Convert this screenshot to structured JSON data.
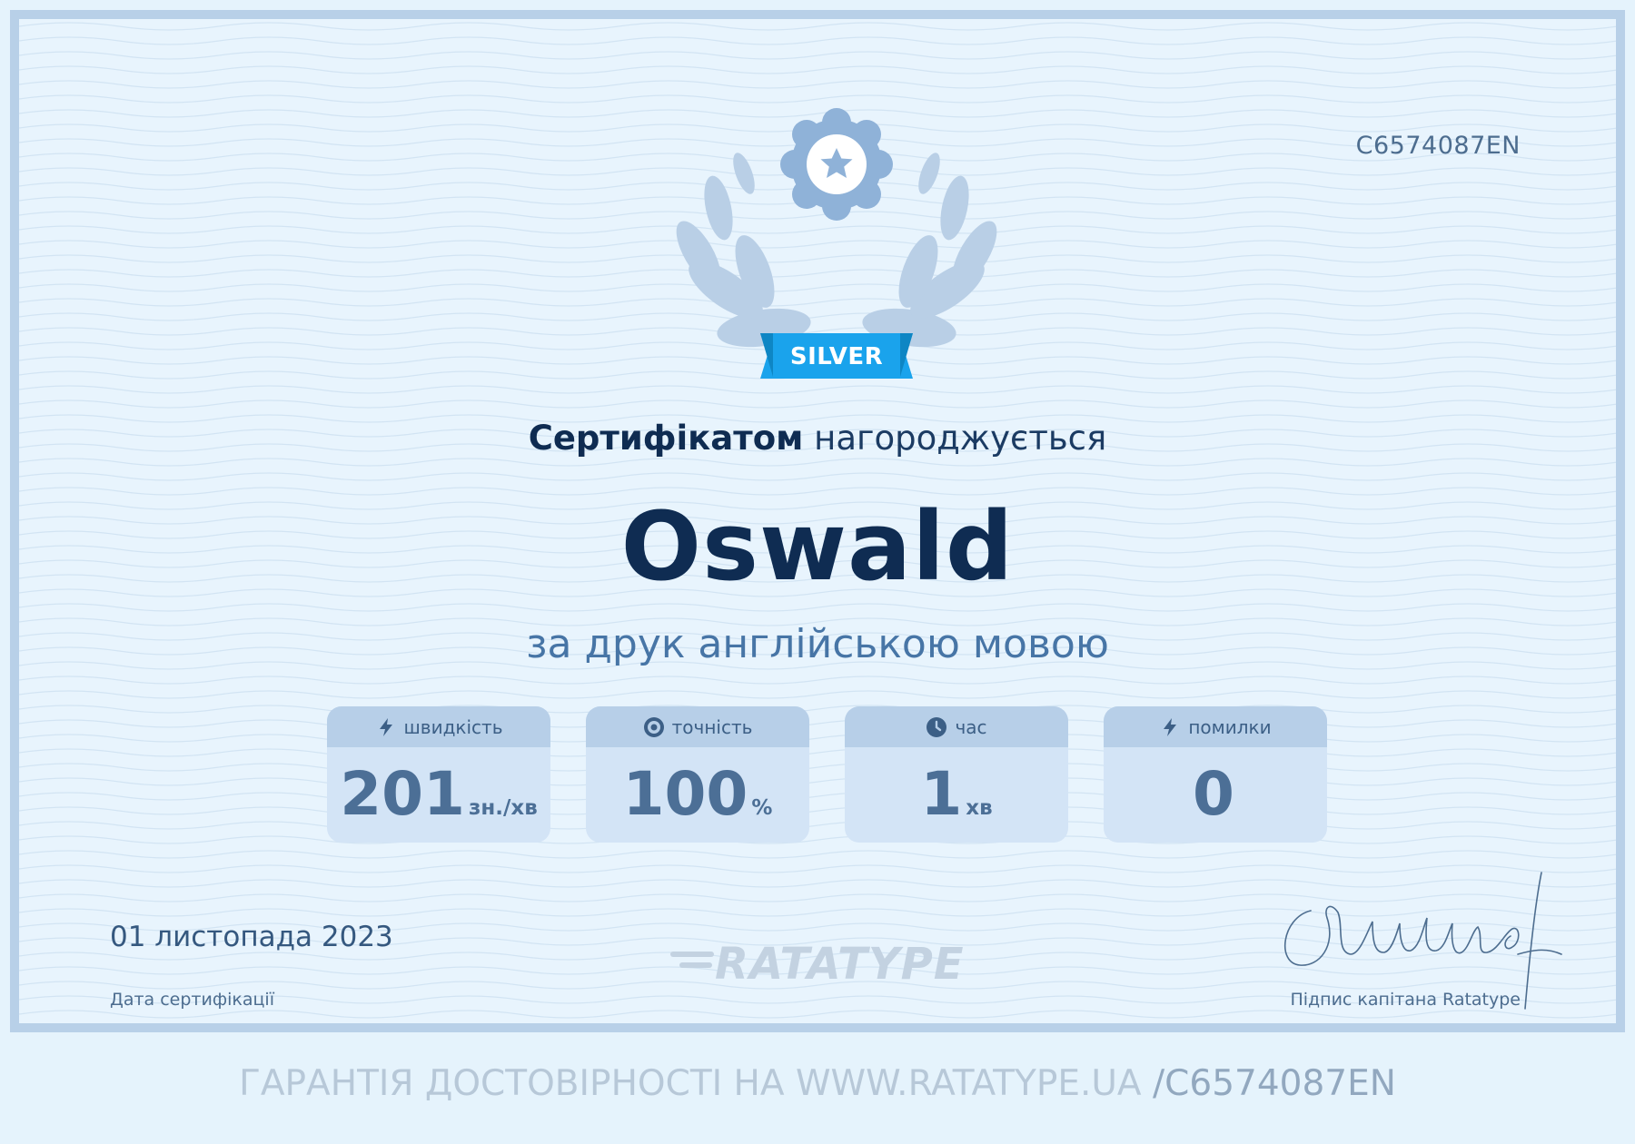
{
  "certificate": {
    "id": "C6574087EN",
    "tier": "SILVER",
    "awarded_bold": "Сертифікатом",
    "awarded_rest": "нагороджується",
    "recipient": "Oswald",
    "reason": "за друк англійською мовою",
    "date": "01 листопада 2023",
    "date_caption": "Дата сертифікації",
    "signature_caption": "Підпис капітана Ratatype",
    "brand": "RATATYPE"
  },
  "stats": [
    {
      "label": "швидкість",
      "value": "201",
      "unit": "зн./хв",
      "icon": "lightning-icon"
    },
    {
      "label": "точність",
      "value": "100",
      "unit": "%",
      "icon": "target-icon"
    },
    {
      "label": "час",
      "value": "1",
      "unit": "хв",
      "icon": "clock-icon"
    },
    {
      "label": "помилки",
      "value": "0",
      "unit": "",
      "icon": "lightning-icon"
    }
  ],
  "verification": {
    "text": "ГАРАНТІЯ ДОСТОВІРНОСТІ НА WWW.RATATYPE.UA",
    "code": "/C6574087EN"
  },
  "colors": {
    "background": "#e8f4fd",
    "frame": "#b8d0e8",
    "navy": "#0f2c52",
    "accent_blue": "#4775a6",
    "ribbon": "#1aa3ec"
  }
}
